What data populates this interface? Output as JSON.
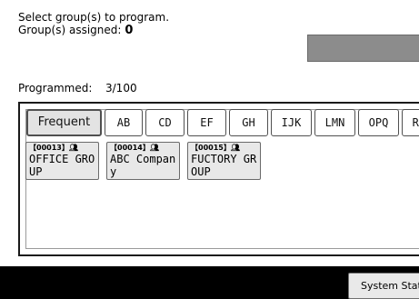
{
  "header": {
    "instruction": "Select group(s) to program.",
    "assigned_label": "Group(s) assigned:",
    "assigned_count": "0"
  },
  "programmed": {
    "label": "Programmed:",
    "count": "3/100"
  },
  "tabs": [
    {
      "label": "Frequent",
      "selected": true
    },
    {
      "label": "AB"
    },
    {
      "label": "CD"
    },
    {
      "label": "EF"
    },
    {
      "label": "GH"
    },
    {
      "label": "IJK"
    },
    {
      "label": "LMN"
    },
    {
      "label": "OPQ"
    },
    {
      "label": "RST"
    }
  ],
  "groups": [
    {
      "number": "【00013】",
      "icon": "group-people-icon",
      "name": "OFFICE GROUP"
    },
    {
      "number": "【00014】",
      "icon": "group-people-icon",
      "name": "ABC Company"
    },
    {
      "number": "【00015】",
      "icon": "group-people-icon",
      "name": "FUCTORY GROUP"
    }
  ],
  "footer": {
    "system_status": "System Status"
  }
}
